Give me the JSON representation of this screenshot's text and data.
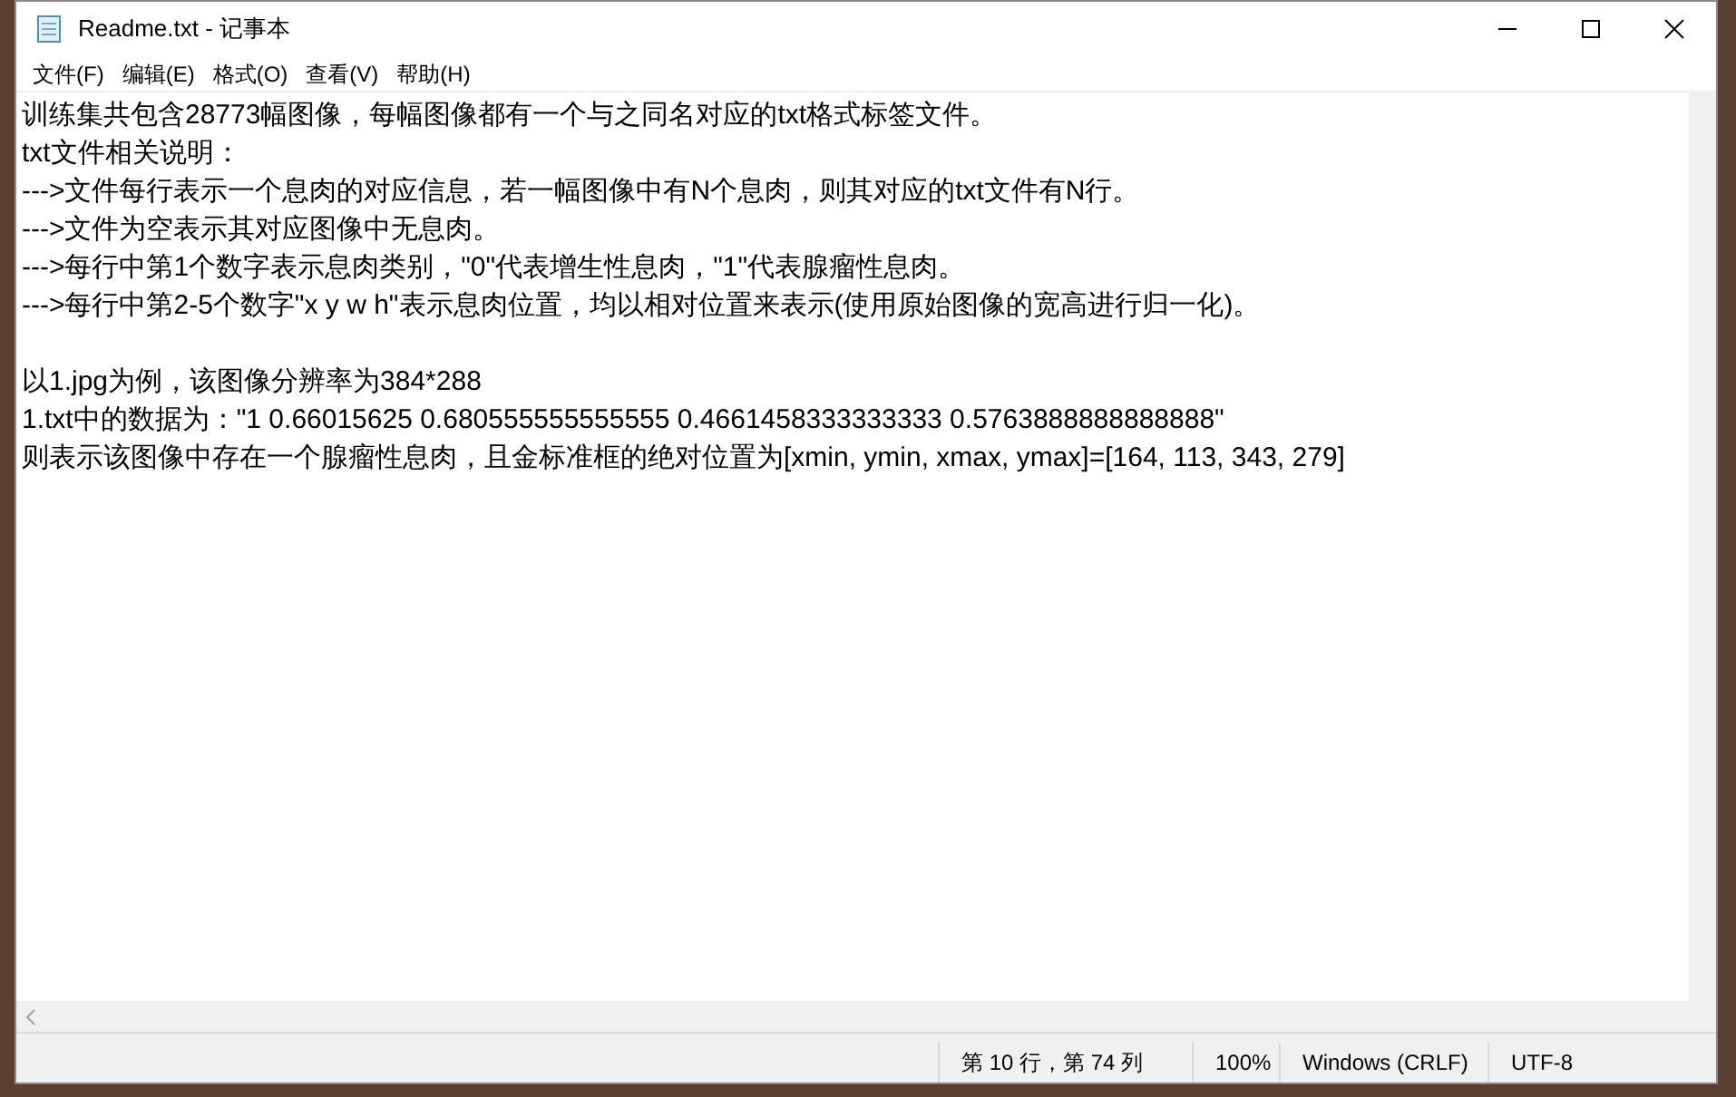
{
  "window": {
    "title": "Readme.txt - 记事本"
  },
  "menu": [
    {
      "label": "文件(F)"
    },
    {
      "label": "编辑(E)"
    },
    {
      "label": "格式(O)"
    },
    {
      "label": "查看(V)"
    },
    {
      "label": "帮助(H)"
    }
  ],
  "paragraphs": [
    [
      "训练集共包含28773幅图像，每幅图像都有一个与之同名对应的txt格式标签文件。",
      "txt文件相关说明：",
      "--->文件每行表示一个息肉的对应信息，若一幅图像中有N个息肉，则其对应的txt文件有N行。",
      "--->文件为空表示其对应图像中无息肉。",
      "--->每行中第1个数字表示息肉类别，\"0\"代表增生性息肉，\"1\"代表腺瘤性息肉。",
      "--->每行中第2-5个数字\"x y w h\"表示息肉位置，均以相对位置来表示(使用原始图像的宽高进行归一化)。"
    ],
    [
      "以1.jpg为例，该图像分辨率为384*288",
      "1.txt中的数据为：\"1 0.66015625 0.680555555555555 0.4661458333333333 0.5763888888888888\"",
      "则表示该图像中存在一个腺瘤性息肉，且金标准框的绝对位置为[xmin, ymin, xmax, ymax]=[164, 113, 343, 279]"
    ]
  ],
  "status_bar": [
    "第 10 行，第 74 列",
    "100%",
    "Windows (CRLF)",
    "UTF-8"
  ]
}
